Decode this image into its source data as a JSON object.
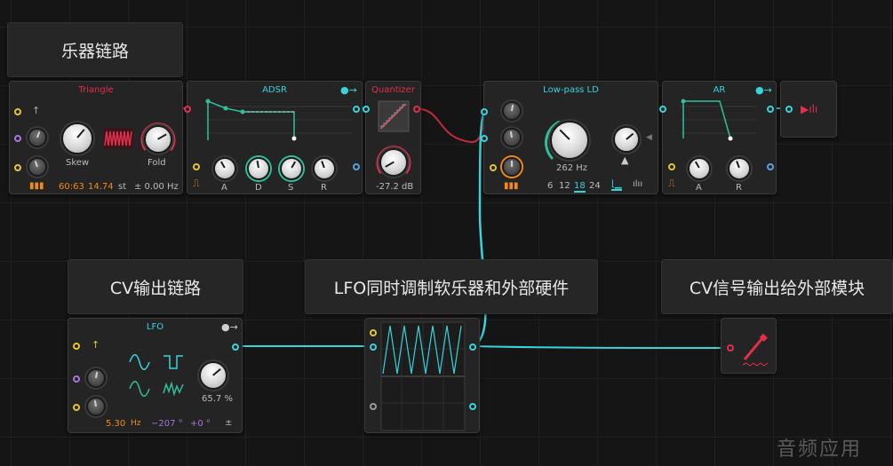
{
  "labels": {
    "instrument_chain": "乐器链路",
    "cv_chain": "CV输出链路",
    "lfo_modulates": "LFO同时调制软乐器和外部硬件",
    "cv_signal_out": "CV信号输出给外部模块"
  },
  "triangle": {
    "title": "Triangle",
    "skew": "Skew",
    "fold": "Fold",
    "pitch": "60:63",
    "semis": "14.74",
    "st": "st",
    "offset": "± 0.00 Hz"
  },
  "adsr": {
    "title": "ADSR",
    "a": "A",
    "d": "D",
    "s": "S",
    "r": "R"
  },
  "quantizer": {
    "title": "Quantizer",
    "value": "-27.2 dB"
  },
  "lowpass": {
    "title": "Low-pass LD",
    "freq": "262 Hz",
    "poles": [
      "6",
      "12",
      "18",
      "24"
    ]
  },
  "ar": {
    "title": "AR",
    "a": "A",
    "r": "R"
  },
  "lfo": {
    "title": "LFO",
    "amount": "65.7 %",
    "rate": "5.30",
    "hz": "Hz",
    "phase": "−207 °",
    "offset": "+0 °",
    "pm": "±"
  },
  "watermark": "音频应用",
  "colors": {
    "cyan": "#3ad3dc",
    "red": "#e0304a",
    "yellow": "#e5c33a",
    "orange": "#f08a1a",
    "purple": "#a875d8",
    "teal": "#2fbf9c"
  }
}
